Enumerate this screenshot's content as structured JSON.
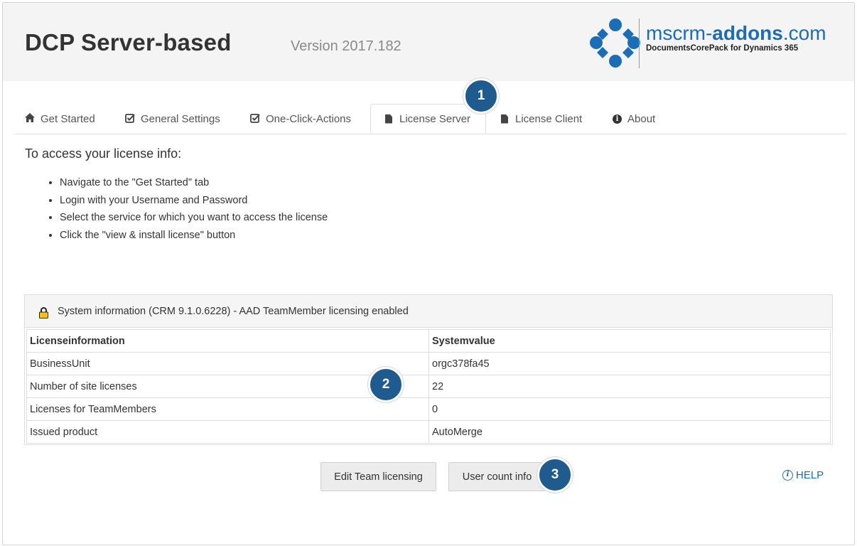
{
  "header": {
    "title": "DCP Server-based",
    "version": "Version 2017.182",
    "logo": {
      "name_prefix": "mscrm-",
      "name_bold": "addons",
      "name_suffix": ".com",
      "tagline": "DocumentsCorePack for Dynamics 365"
    }
  },
  "tabs": [
    {
      "label": "Get Started",
      "icon": "home-icon"
    },
    {
      "label": "General Settings",
      "icon": "check-square-icon"
    },
    {
      "label": "One-Click-Actions",
      "icon": "check-square-icon"
    },
    {
      "label": "License Server",
      "icon": "document-icon",
      "active": true
    },
    {
      "label": "License Client",
      "icon": "document-icon"
    },
    {
      "label": "About",
      "icon": "info-icon"
    }
  ],
  "main": {
    "intro": "To access your license info:",
    "steps": [
      "Navigate to the \"Get Started\" tab",
      "Login with your Username and Password",
      "Select the service for which you want to access the license",
      "Click the \"view & install license\" button"
    ]
  },
  "panel": {
    "title": "System information (CRM 9.1.0.6228) - AAD TeamMember licensing enabled",
    "columns": [
      "Licenseinformation",
      "Systemvalue"
    ],
    "rows": [
      {
        "label": "BusinessUnit",
        "value": "orgc378fa45"
      },
      {
        "label": "Number of site licenses",
        "value": "22"
      },
      {
        "label": "Licenses for TeamMembers",
        "value": "0"
      },
      {
        "label": "Issued product",
        "value": "AutoMerge"
      }
    ]
  },
  "buttons": {
    "edit_team": "Edit Team licensing",
    "user_count": "User count info",
    "help": "HELP"
  },
  "markers": [
    "1",
    "2",
    "3"
  ],
  "colors": {
    "accent": "#1b6db5",
    "marker": "#1f5b8e",
    "header_bg": "#f4f4f4"
  }
}
